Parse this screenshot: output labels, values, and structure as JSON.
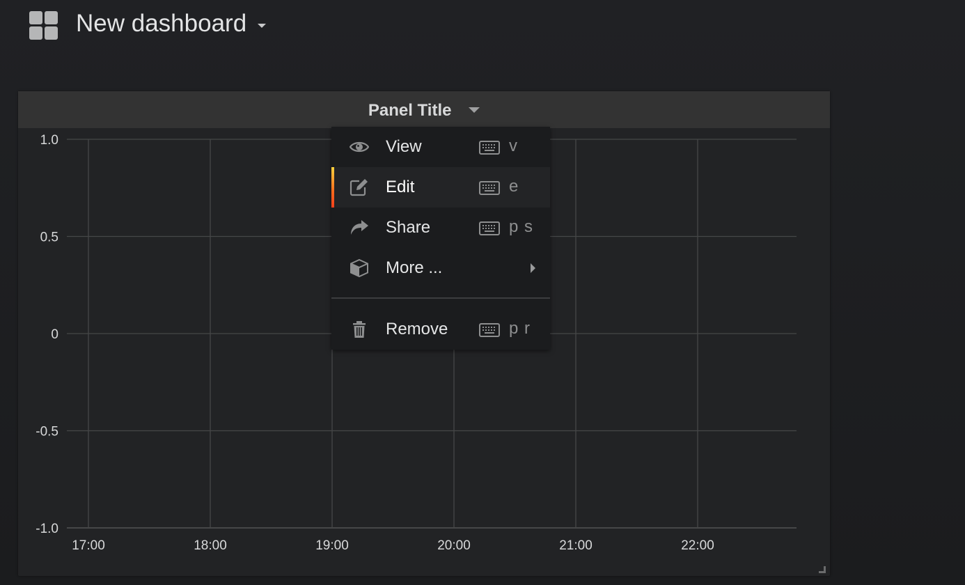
{
  "header": {
    "title": "New dashboard",
    "icon": "dashboard-grid-icon"
  },
  "panel": {
    "title": "Panel Title",
    "menu": {
      "items": [
        {
          "label": "View",
          "icon": "eye-icon",
          "shortcut": "v",
          "active": false
        },
        {
          "label": "Edit",
          "icon": "edit-icon",
          "shortcut": "e",
          "active": true
        },
        {
          "label": "Share",
          "icon": "share-icon",
          "shortcut": "p s",
          "active": false
        },
        {
          "label": "More ...",
          "icon": "cube-icon",
          "shortcut": "",
          "submenu": true,
          "active": false
        }
      ],
      "remove": {
        "label": "Remove",
        "icon": "trash-icon",
        "shortcut": "p r"
      }
    },
    "colors": {
      "active_accent_top": "#ffd23f",
      "active_accent_bottom": "#f33f1b",
      "grid": "#464748",
      "tick_text": "#d8d9da"
    }
  },
  "chart_data": {
    "type": "line",
    "title": "Panel Title",
    "series": [],
    "x_ticks": [
      "17:00",
      "18:00",
      "19:00",
      "20:00",
      "21:00",
      "22:00"
    ],
    "y_ticks": [
      "1.0",
      "0.5",
      "0",
      "-0.5",
      "-1.0"
    ],
    "y_tick_values": [
      1.0,
      0.5,
      0,
      -0.5,
      -1.0
    ],
    "ylim": [
      -1.0,
      1.0
    ],
    "xlim": [
      "16:58",
      "22:48"
    ],
    "grid": true,
    "xlabel": "",
    "ylabel": ""
  }
}
